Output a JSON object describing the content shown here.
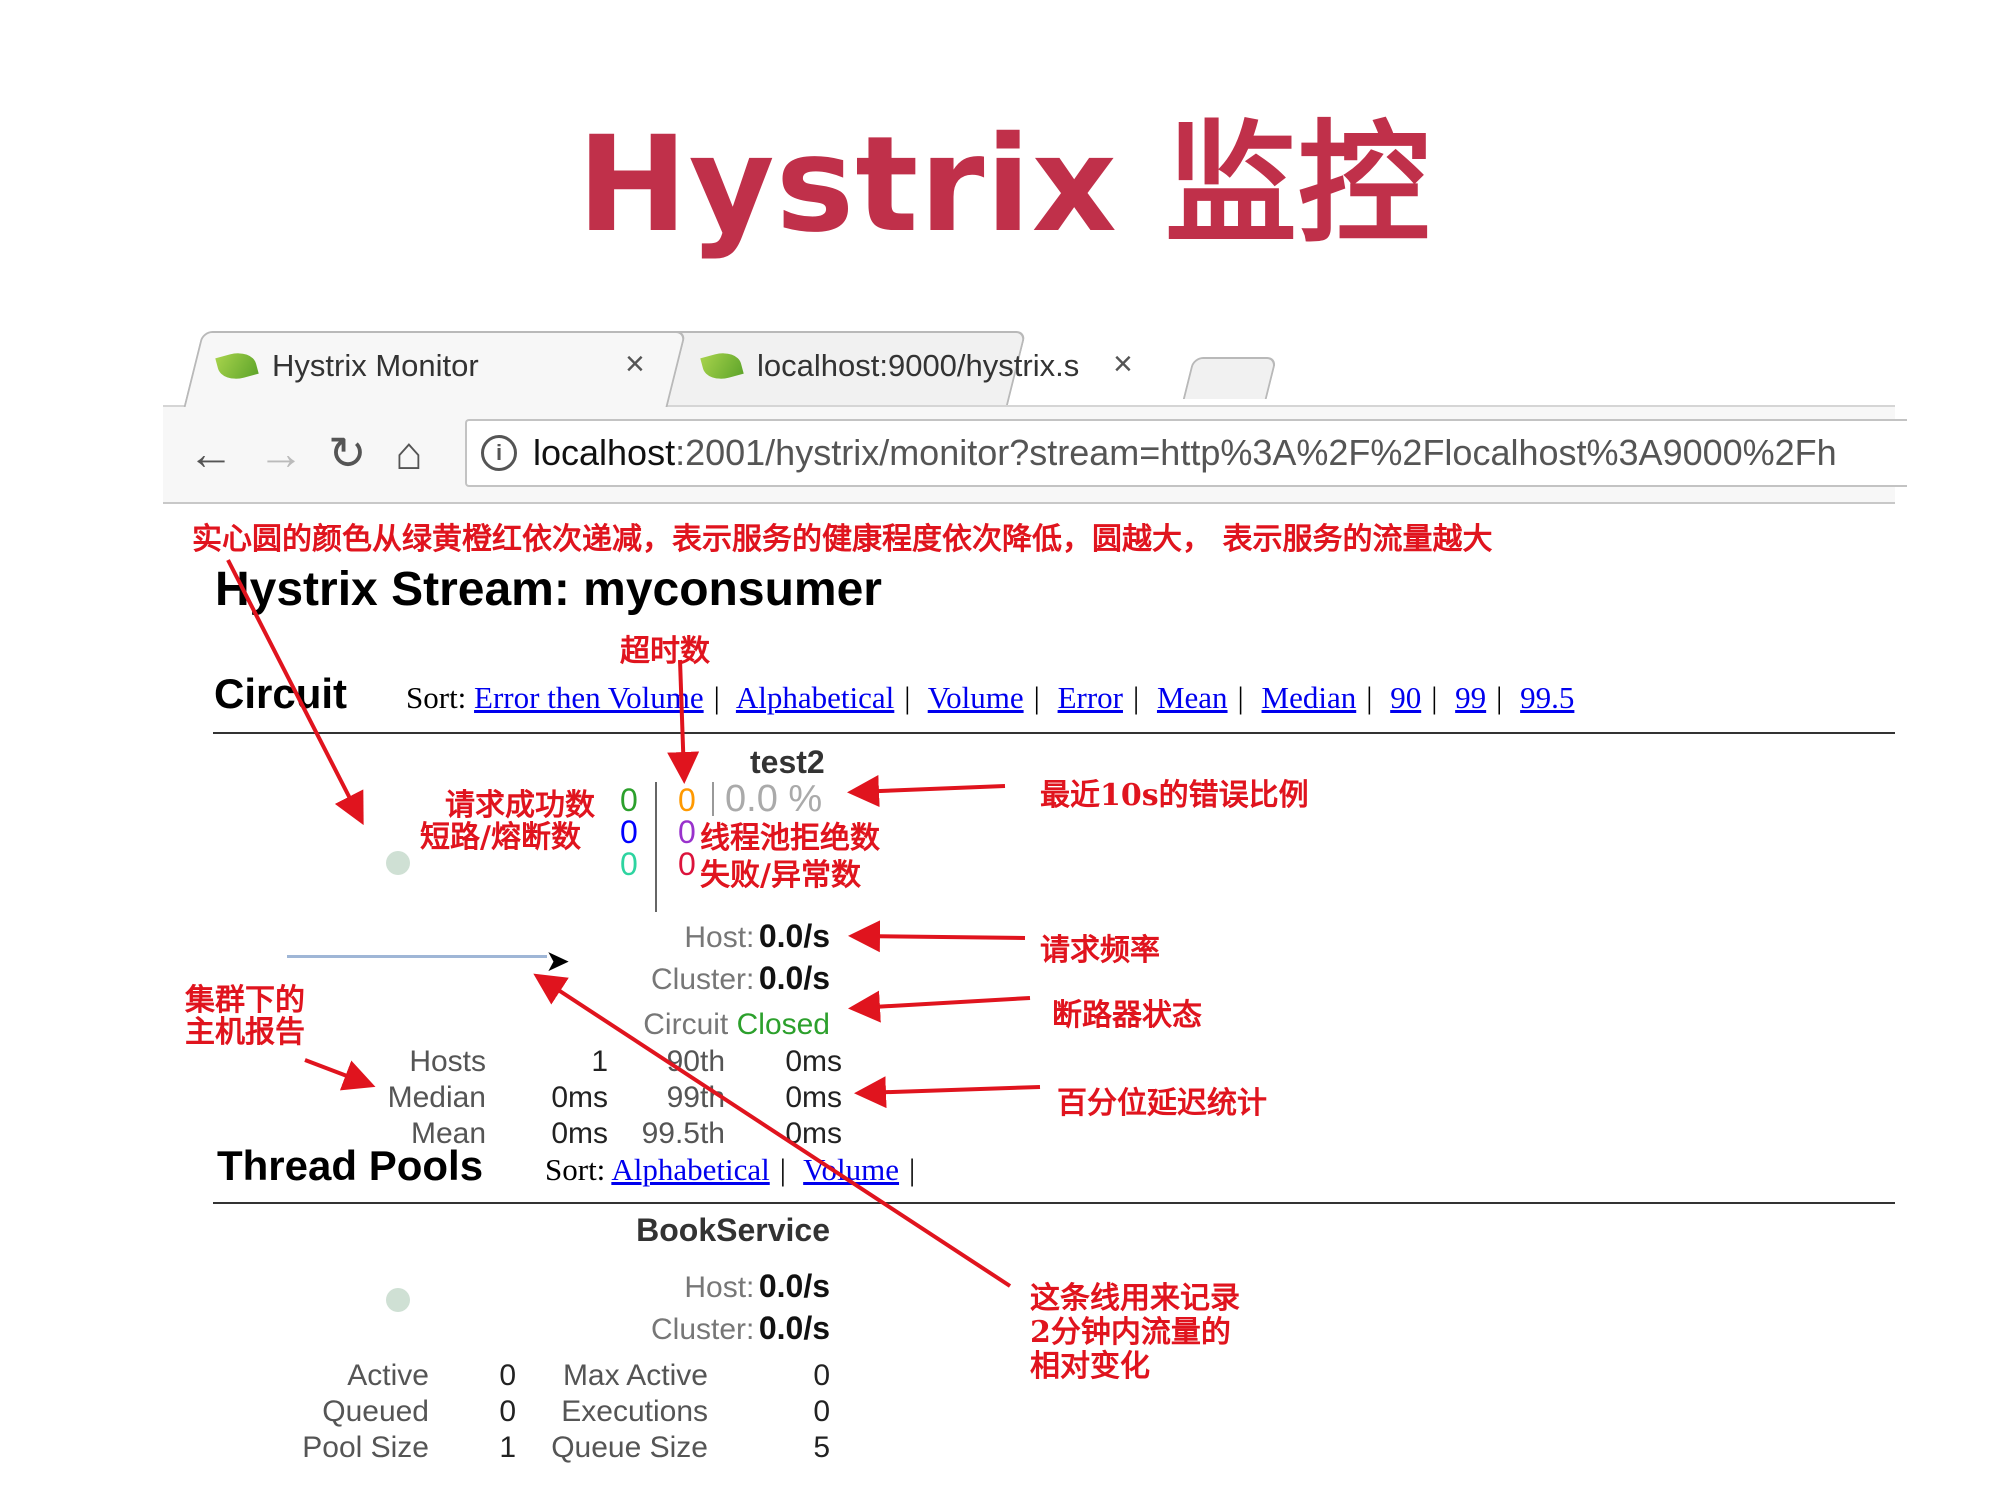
{
  "slide": {
    "title": "Hystrix 监控"
  },
  "browser": {
    "tabs": [
      {
        "label": "Hystrix Monitor",
        "close": "×"
      },
      {
        "label": "localhost:9000/hystrix.s",
        "close": "×"
      }
    ],
    "url_prefix": "localhost",
    "url_rest": ":2001/hystrix/monitor?stream=http%3A%2F%2Flocalhost%3A9000%2Fh",
    "nav": {
      "back": "←",
      "forward": "→",
      "reload": "↻",
      "home": "⌂"
    },
    "info_icon": "i"
  },
  "annotations": {
    "top_note": "实心圆的颜色从绿黄橙红依次递减，表示服务的健康程度依次降低，圆越大，  表示服务的流量越大",
    "timeout": "超时数",
    "success": "请求成功数",
    "short_circuit": "短路/熔断数",
    "thread_reject": "线程池拒绝数",
    "failure": "失败/异常数",
    "error_ratio": "最近10s的错误比例",
    "request_rate": "请求频率",
    "breaker_state": "断路器状态",
    "percentile": "百分位延迟统计",
    "cluster_hosts_l1": "集群下的",
    "cluster_hosts_l2": "主机报告",
    "line_note_l1": "这条线用来记录",
    "line_note_l2": "2分钟内流量的",
    "line_note_l3": "相对变化"
  },
  "dashboard": {
    "stream_title": "Hystrix Stream: myconsumer",
    "circuit_heading": "Circuit",
    "sort_label": "Sort:",
    "circuit_sorts": [
      "Error then Volume",
      "Alphabetical",
      "Volume",
      "Error",
      "Mean",
      "Median",
      "90",
      "99",
      "99.5"
    ],
    "circuit": {
      "name": "test2",
      "success_count": "0",
      "short_circuited_count": "0",
      "bad_request_count": "0",
      "timeout_count": "0",
      "rejected_count": "0",
      "failure_count": "0",
      "error_pct": "0.0 %",
      "host_label": "Host:",
      "host_rate": "0.0/s",
      "cluster_label": "Cluster:",
      "cluster_rate": "0.0/s",
      "circuit_label": "Circuit",
      "circuit_status": "Closed",
      "stats": [
        [
          "Hosts",
          "1",
          "90th",
          "0ms"
        ],
        [
          "Median",
          "0ms",
          "99th",
          "0ms"
        ],
        [
          "Mean",
          "0ms",
          "99.5th",
          "0ms"
        ]
      ]
    },
    "threadpool_heading": "Thread Pools",
    "threadpool_sorts": [
      "Alphabetical",
      "Volume"
    ],
    "threadpool": {
      "name": "BookService",
      "host_label": "Host:",
      "host_rate": "0.0/s",
      "cluster_label": "Cluster:",
      "cluster_rate": "0.0/s",
      "stats": [
        [
          "Active",
          "0",
          "Max Active",
          "0"
        ],
        [
          "Queued",
          "0",
          "Executions",
          "0"
        ],
        [
          "Pool Size",
          "1",
          "Queue Size",
          "5"
        ]
      ]
    }
  },
  "colors": {
    "title": "#c0304a",
    "annotation": "#e0141e",
    "success": "#2ca02c",
    "short_circuit": "#0000ff",
    "bad_request": "#2dd4a0",
    "timeout": "#ff9900",
    "rejected": "#9932cc",
    "failure": "#dc143c",
    "closed": "#2ca02c",
    "link": "#0000ee"
  }
}
